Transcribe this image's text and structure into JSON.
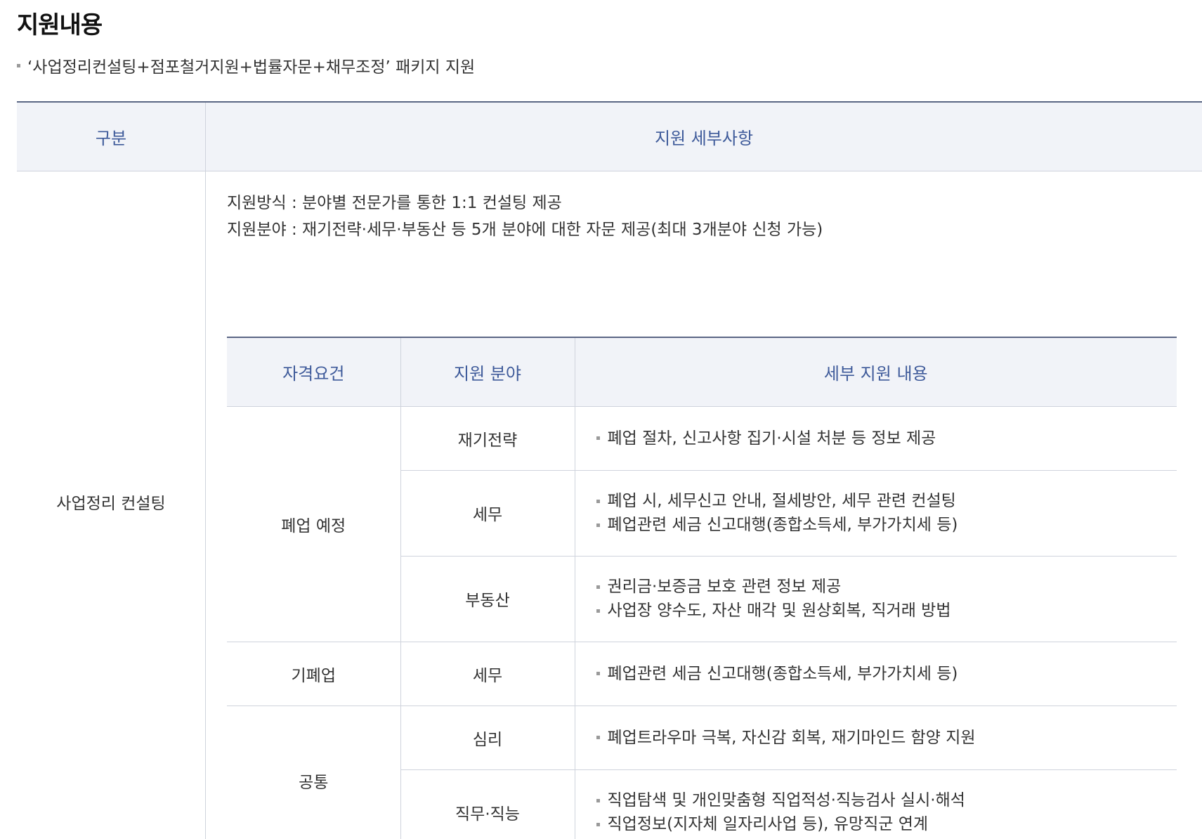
{
  "title": "지원내용",
  "intro": "‘사업정리컨설팅+점포철거지원+법률자문+채무조정’ 패키지 지원",
  "outer_table": {
    "headers": [
      "구분",
      "지원 세부사항"
    ],
    "category": "사업정리 컨설팅",
    "method_line": "지원방식 : 분야별 전문가를 통한 1:1 컨설팅 제공",
    "field_line": "지원분야 : 재기전략·세무·부동산 등 5개 분야에 대한 자문 제공(최대 3개분야 신청 가능)"
  },
  "inner_table": {
    "headers": [
      "자격요건",
      "지원 분야",
      "세부 지원 내용"
    ],
    "groups": [
      {
        "requirement": "폐업 예정",
        "rows": [
          {
            "field": "재기전략",
            "details": [
              "폐업 절차, 신고사항 집기·시설 처분 등 정보 제공"
            ]
          },
          {
            "field": "세무",
            "details": [
              "폐업 시, 세무신고 안내, 절세방안, 세무 관련 컨설팅",
              "폐업관련 세금 신고대행(종합소득세, 부가가치세 등)"
            ]
          },
          {
            "field": "부동산",
            "details": [
              "권리금·보증금 보호 관련 정보 제공",
              "사업장 양수도, 자산 매각 및 원상회복, 직거래 방법"
            ]
          }
        ]
      },
      {
        "requirement": "기폐업",
        "rows": [
          {
            "field": "세무",
            "details": [
              "폐업관련 세금 신고대행(종합소득세, 부가가치세 등)"
            ]
          }
        ]
      },
      {
        "requirement": "공통",
        "rows": [
          {
            "field": "심리",
            "details": [
              "폐업트라우마 극복, 자신감 회복, 재기마인드 함양 지원"
            ]
          },
          {
            "field": "직무·직능",
            "details": [
              "직업탐색 및 개인맞춤형 직업적성·직능검사 실시·해석",
              "직업정보(지자체 일자리사업 등), 유망직군 연계"
            ]
          }
        ]
      }
    ]
  },
  "colors": {
    "header_bg": "#f1f3f8",
    "header_text": "#3e5a9a",
    "header_rule": "#5a6684",
    "border": "#cfd3dc",
    "bullet": "#9a9a9a"
  }
}
